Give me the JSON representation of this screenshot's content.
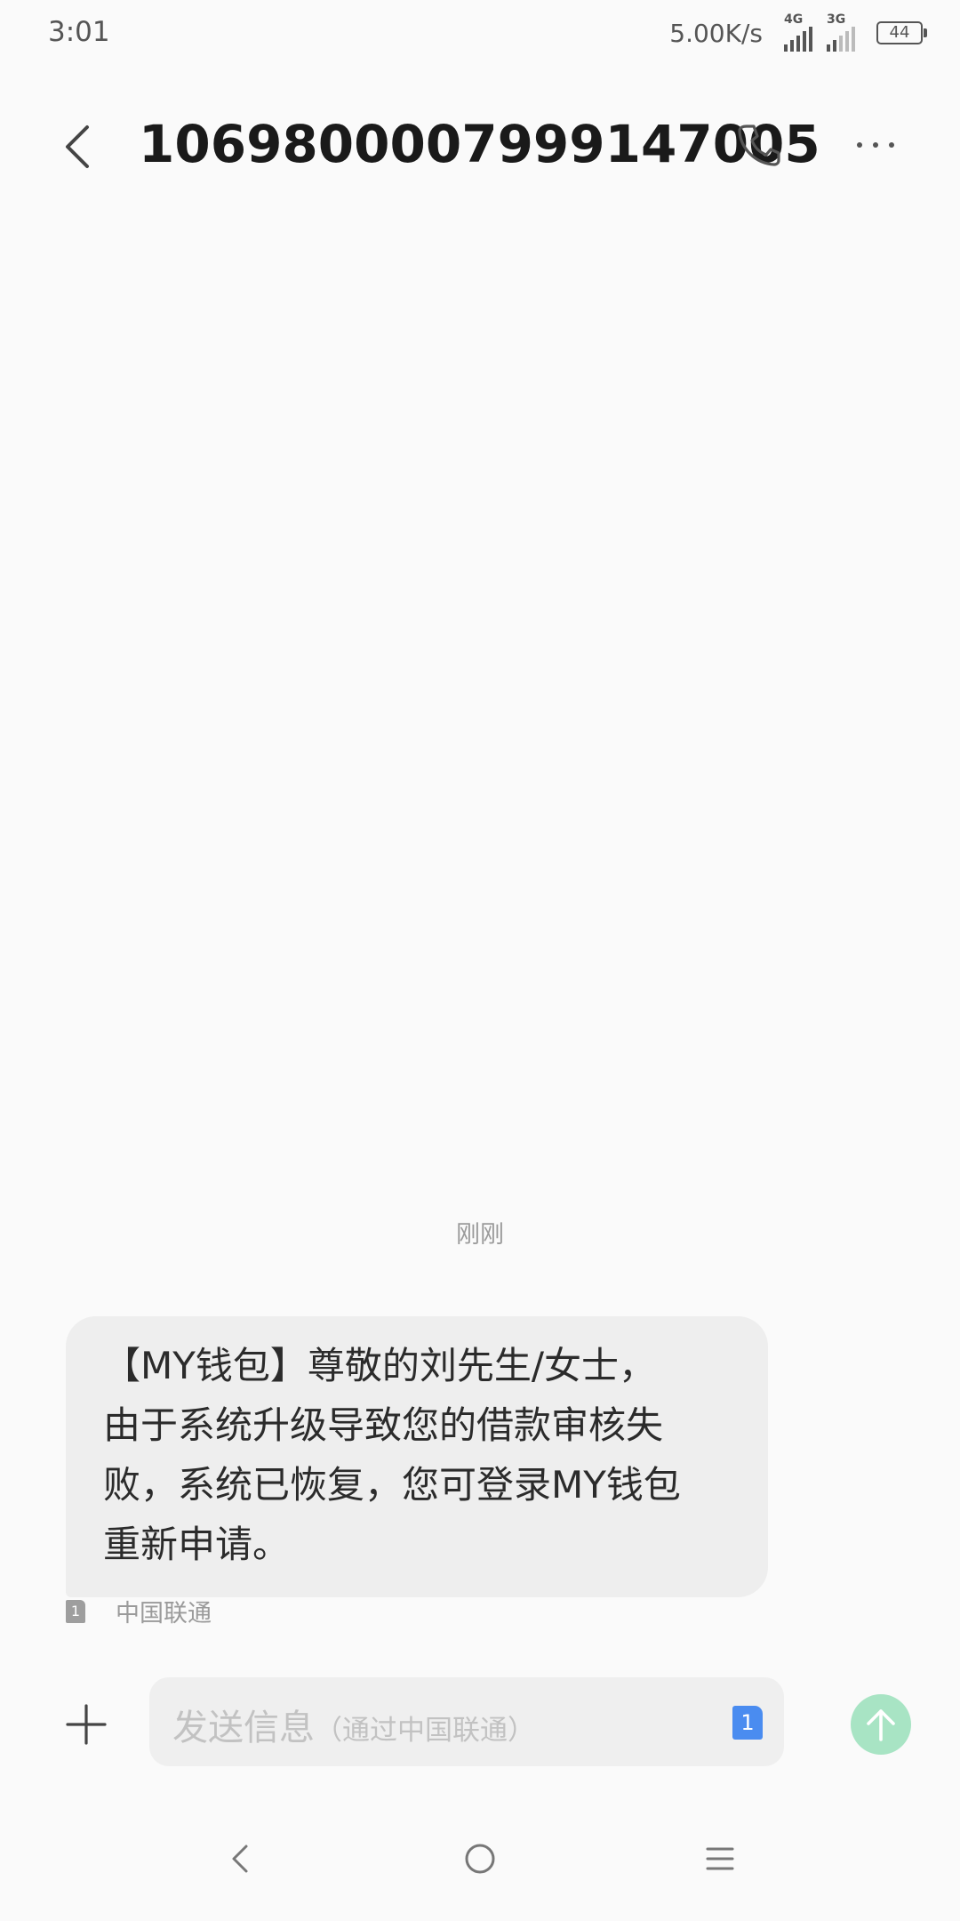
{
  "status_bar": {
    "time": "3:01",
    "net_speed": "5.00K/s",
    "signal_1_label": "4G",
    "signal_2_label": "3G",
    "battery": "44"
  },
  "header": {
    "title": "1069800007999147005",
    "icons": [
      "back-arrow-icon",
      "phone-icon",
      "more-icon"
    ]
  },
  "conversation": {
    "timestamp": "刚刚",
    "messages": [
      {
        "lines": [
          "【MY钱包】尊敬的刘先生/女士，",
          "由于系统升级导致您的借款审核失",
          "败，系统已恢复，您可登录MY钱包",
          "重新申请。"
        ],
        "sim_slot": "1",
        "carrier": "中国联通"
      }
    ]
  },
  "composer": {
    "placeholder": "发送信息",
    "placeholder_sub": "（通过中国联通）",
    "sim_slot": "1",
    "send_button_color": "#a8e4c4",
    "sim_badge_color": "#4a8cf0"
  },
  "nav_bar": {
    "icons": [
      "nav-back-icon",
      "nav-home-icon",
      "nav-recents-icon"
    ]
  }
}
